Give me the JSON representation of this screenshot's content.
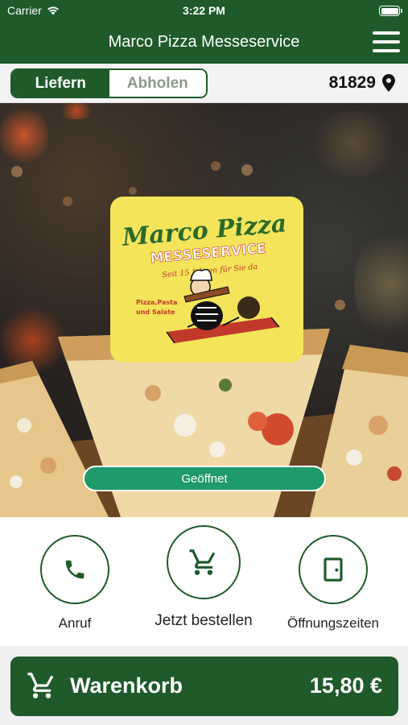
{
  "status_bar": {
    "carrier": "Carrier",
    "time": "3:22 PM"
  },
  "nav": {
    "title": "Marco Pizza Messeservice"
  },
  "mode": {
    "deliver_label": "Liefern",
    "pickup_label": "Abholen",
    "active": "deliver",
    "zip": "81829"
  },
  "logo": {
    "line1": "Marco Pizza",
    "line2": "MESSESERVICE",
    "tagline": "Seit 15 Jahren für Sie da",
    "side_text": [
      "Pizza,Pasta",
      "und Salate"
    ]
  },
  "status_pill": {
    "label": "Geöffnet"
  },
  "actions": [
    {
      "label": "Anruf",
      "icon": "phone-icon"
    },
    {
      "label": "Jetzt bestellen",
      "icon": "cart-icon"
    },
    {
      "label": "Öffnungszeiten",
      "icon": "door-icon"
    }
  ],
  "cart": {
    "label": "Warenkorb",
    "total": "15,80 €"
  },
  "colors": {
    "primary": "#1e5a2a",
    "open": "#1f9a6a",
    "logo_bg": "#f4e45a"
  }
}
